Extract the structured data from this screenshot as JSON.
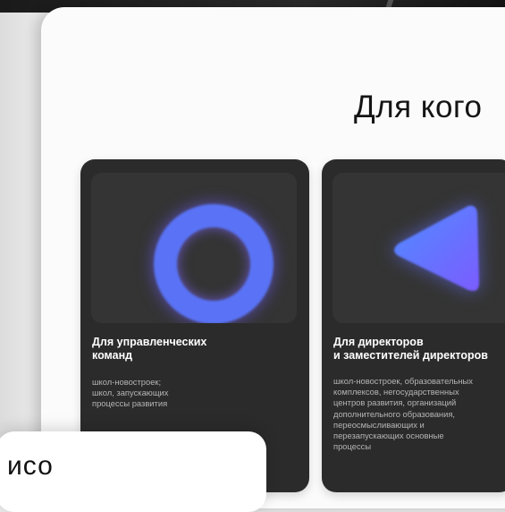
{
  "section": {
    "title": "Для кого"
  },
  "cards": [
    {
      "icon": "gradient-ring-icon",
      "title_lines": [
        "Для управленческих",
        "команд"
      ],
      "desc_lines": [
        "школ-новостроек;",
        "школ, запускающих",
        "процессы развития"
      ]
    },
    {
      "icon": "gradient-triangle-icon",
      "title_lines": [
        "Для директоров",
        "и заместителей директоров"
      ],
      "desc_lines": [
        "школ-новостроек, образовательных",
        "комплексов, негосударственных",
        "центров развития, организаций",
        "дополнительного образования,",
        "переосмысливающих и",
        "перезапускающих основные",
        "процессы"
      ]
    }
  ],
  "overlay": {
    "text": "исо"
  },
  "colors": {
    "card_bg": "#2b2b2b",
    "accent_blue": "#5a73f6",
    "accent_violet": "#7b5cff"
  }
}
